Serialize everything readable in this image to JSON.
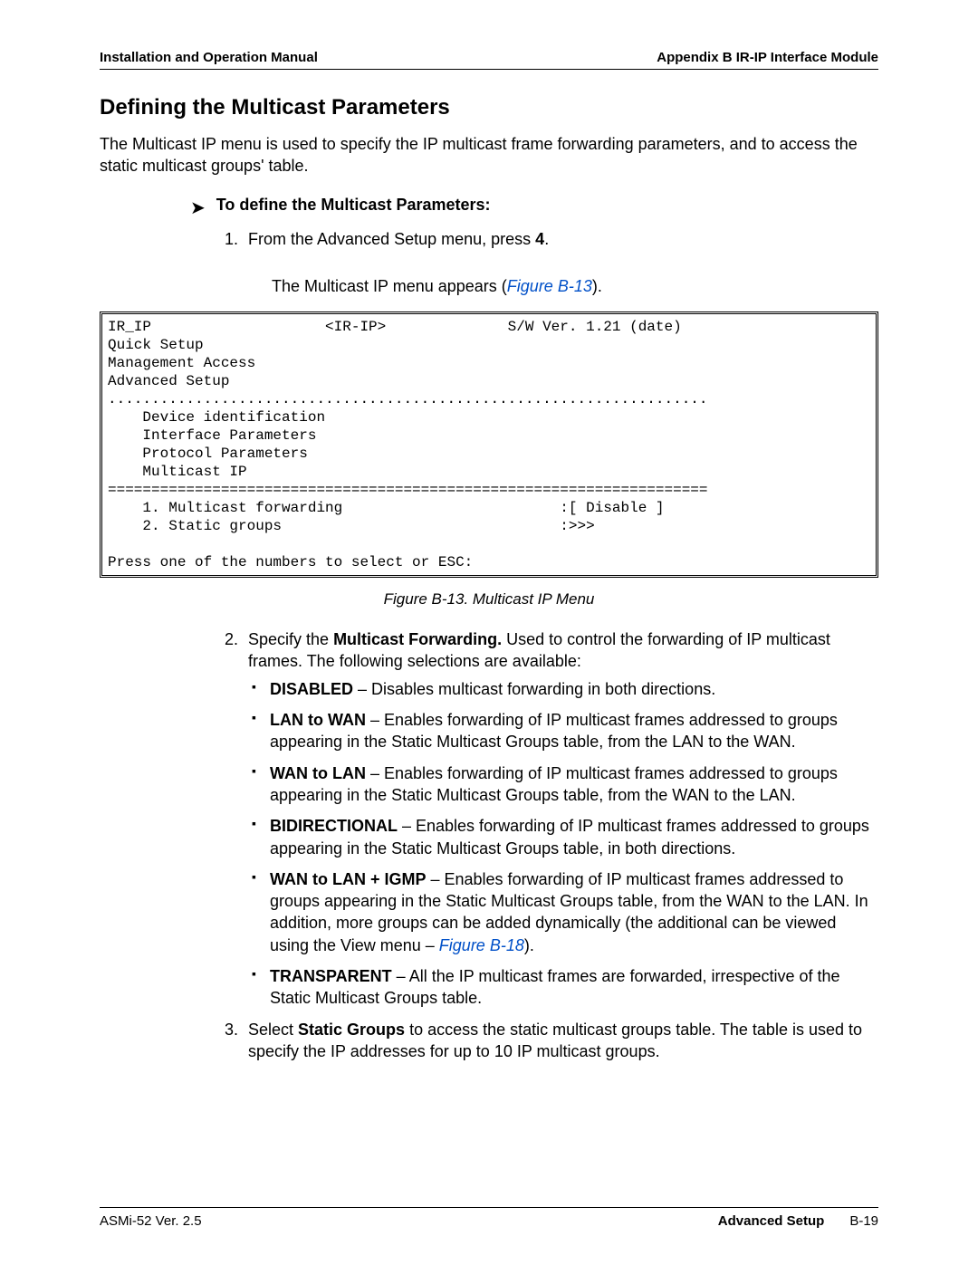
{
  "header": {
    "left": "Installation and Operation Manual",
    "right": "Appendix B  IR-IP Interface Module"
  },
  "section_title": "Defining the Multicast Parameters",
  "intro_para": "The Multicast IP menu is used to specify the IP multicast frame forwarding parameters, and to access the static multicast groups' table.",
  "task_heading": "To define the Multicast Parameters:",
  "step1": {
    "prefix": "From the Advanced Setup menu, press ",
    "key": "4",
    "suffix": "."
  },
  "step1_result_prefix": "The Multicast IP menu appears (",
  "step1_result_ref": "Figure B-13",
  "step1_result_suffix": ").",
  "terminal": "IR_IP                    <IR-IP>              S/W Ver. 1.21 (date)\nQuick Setup\nManagement Access\nAdvanced Setup\n.....................................................................\n    Device identification\n    Interface Parameters\n    Protocol Parameters\n    Multicast IP\n=====================================================================\n    1. Multicast forwarding                         :[ Disable ]\n    2. Static groups                                :>>>\n\nPress one of the numbers to select or ESC:",
  "figure_caption": "Figure B-13.  Multicast IP Menu",
  "step2": {
    "prefix": "Specify the ",
    "bold": "Multicast Forwarding.",
    "suffix": " Used to control the forwarding of IP multicast frames. The following selections are available:"
  },
  "bullets": {
    "disabled": {
      "name": "DISABLED",
      "text": " – Disables multicast forwarding in both directions."
    },
    "lan_to_wan": {
      "name": "LAN to WAN",
      "text": " – Enables forwarding of IP multicast frames addressed to groups appearing in the Static Multicast Groups table, from the LAN to the WAN."
    },
    "wan_to_lan": {
      "name": "WAN to LAN",
      "text": " – Enables forwarding of IP multicast frames addressed to groups appearing in the Static Multicast Groups table, from the WAN to the LAN."
    },
    "bidirectional": {
      "name": "BIDIRECTIONAL",
      "text": " – Enables forwarding of IP multicast frames addressed to groups appearing in the Static Multicast Groups table, in both directions."
    },
    "wan_to_lan_igmp": {
      "name": "WAN to LAN + IGMP",
      "text_before_ref": " – Enables forwarding of IP multicast frames addressed to groups appearing in the Static Multicast Groups table, from the WAN to the LAN. In addition, more groups can be added dynamically (the additional can be viewed using the View menu – ",
      "ref": "Figure B-18",
      "text_after_ref": ")."
    },
    "transparent": {
      "name": "TRANSPARENT",
      "text": " – All the IP multicast frames are forwarded, irrespective of the Static Multicast Groups table."
    }
  },
  "step3": {
    "prefix": "Select ",
    "bold": "Static Groups",
    "suffix": " to access the static multicast groups table. The table is used to specify the IP addresses for up to 10 IP multicast groups."
  },
  "footer": {
    "left": "ASMi-52 Ver. 2.5",
    "section": "Advanced Setup",
    "page": "B-19"
  }
}
